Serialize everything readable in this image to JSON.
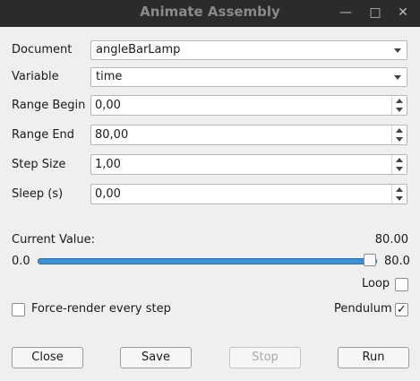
{
  "window": {
    "title": "Animate Assembly",
    "minimize_glyph": "—",
    "maximize_glyph": "□",
    "close_glyph": "✕"
  },
  "form": {
    "document_label": "Document",
    "document_value": "angleBarLamp",
    "variable_label": "Variable",
    "variable_value": "time",
    "range_begin_label": "Range Begin",
    "range_begin_value": "0,00",
    "range_end_label": "Range End",
    "range_end_value": "80,00",
    "step_size_label": "Step Size",
    "step_size_value": "1,00",
    "sleep_label": "Sleep (s)",
    "sleep_value": "0,00"
  },
  "slider": {
    "current_value_label": "Current Value:",
    "current_value": "80.00",
    "min_label": "0.0",
    "max_label": "80.0",
    "position_fraction": 1.0
  },
  "options": {
    "loop_label": "Loop",
    "loop_checked": false,
    "force_render_label": "Force-render every step",
    "force_render_checked": false,
    "pendulum_label": "Pendulum",
    "pendulum_checked": true,
    "check_glyph": "✓"
  },
  "buttons": {
    "close": "Close",
    "save": "Save",
    "stop": "Stop",
    "run": "Run"
  }
}
